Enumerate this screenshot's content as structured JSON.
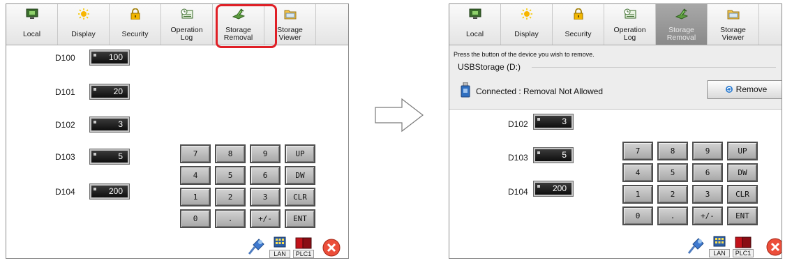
{
  "tabs": [
    {
      "key": "local",
      "label": "Local",
      "icon": "monitor-icon"
    },
    {
      "key": "display",
      "label": "Display",
      "icon": "sun-icon"
    },
    {
      "key": "security",
      "label": "Security",
      "icon": "padlock-icon"
    },
    {
      "key": "operation-log",
      "label": "Operation\nLog",
      "icon": "log-screen-icon"
    },
    {
      "key": "storage-removal",
      "label": "Storage\nRemoval",
      "icon": "storage-eject-icon"
    },
    {
      "key": "storage-viewer",
      "label": "Storage\nViewer",
      "icon": "folder-icon"
    }
  ],
  "left_screen": {
    "devices": [
      {
        "label": "D100",
        "value": "100"
      },
      {
        "label": "D101",
        "value": "20"
      },
      {
        "label": "D102",
        "value": "3"
      },
      {
        "label": "D103",
        "value": "5"
      },
      {
        "label": "D104",
        "value": "200"
      }
    ],
    "active_tab": "none"
  },
  "right_screen": {
    "active_tab": "Storage Removal",
    "panel": {
      "message": "Press the button of the device you wish to remove.",
      "device_name": "USBStorage (D:)",
      "status": "Connected : Removal Not Allowed",
      "remove_label": "Remove"
    },
    "devices": [
      {
        "label": "D102",
        "value": "3"
      },
      {
        "label": "D103",
        "value": "5"
      },
      {
        "label": "D104",
        "value": "200"
      }
    ]
  },
  "keypad": [
    [
      "7",
      "8",
      "9",
      "UP"
    ],
    [
      "4",
      "5",
      "6",
      "DW"
    ],
    [
      "1",
      "2",
      "3",
      "CLR"
    ],
    [
      "0",
      ".",
      "+/-",
      "ENT"
    ]
  ],
  "bottom_icons": {
    "lan": "LAN",
    "plc": "PLC1"
  },
  "colors": {
    "highlight": "#e01f26",
    "active_tab": "#8a8a8a"
  }
}
